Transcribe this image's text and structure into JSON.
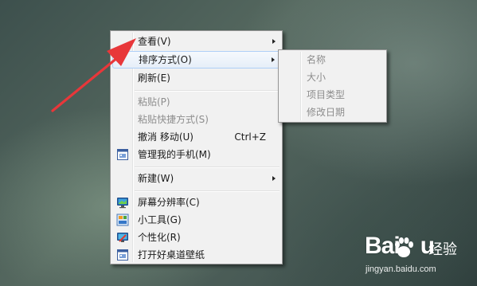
{
  "context_menu": {
    "items": [
      {
        "label": "查看(V)",
        "submenu": true
      },
      {
        "label": "排序方式(O)",
        "submenu": true,
        "highlighted": true
      },
      {
        "label": "刷新(E)"
      },
      {
        "label": "粘贴(P)",
        "disabled": true
      },
      {
        "label": "粘贴快捷方式(S)",
        "disabled": true
      },
      {
        "label": "撤消 移动(U)",
        "shortcut": "Ctrl+Z"
      },
      {
        "label": "管理我的手机(M)",
        "icon": "phone-manager-icon"
      },
      {
        "label": "新建(W)",
        "submenu": true
      },
      {
        "label": "屏幕分辨率(C)",
        "icon": "monitor-icon"
      },
      {
        "label": "小工具(G)",
        "icon": "gadgets-icon"
      },
      {
        "label": "个性化(R)",
        "icon": "personalize-icon"
      },
      {
        "label": "打开好桌道壁纸",
        "icon": "wallpaper-app-icon"
      }
    ]
  },
  "sort_submenu": {
    "items": [
      {
        "label": "名称",
        "disabled": true
      },
      {
        "label": "大小",
        "disabled": true
      },
      {
        "label": "项目类型",
        "disabled": true
      },
      {
        "label": "修改日期",
        "disabled": true
      }
    ]
  },
  "annotation": {
    "icon": "red-arrow-icon",
    "color": "#e8373a"
  },
  "watermark": {
    "brand": "Bai",
    "brand_tail": "u",
    "jingyan": "经验",
    "url": "jingyan.baidu.com",
    "icon": "baidu-paw-icon"
  }
}
